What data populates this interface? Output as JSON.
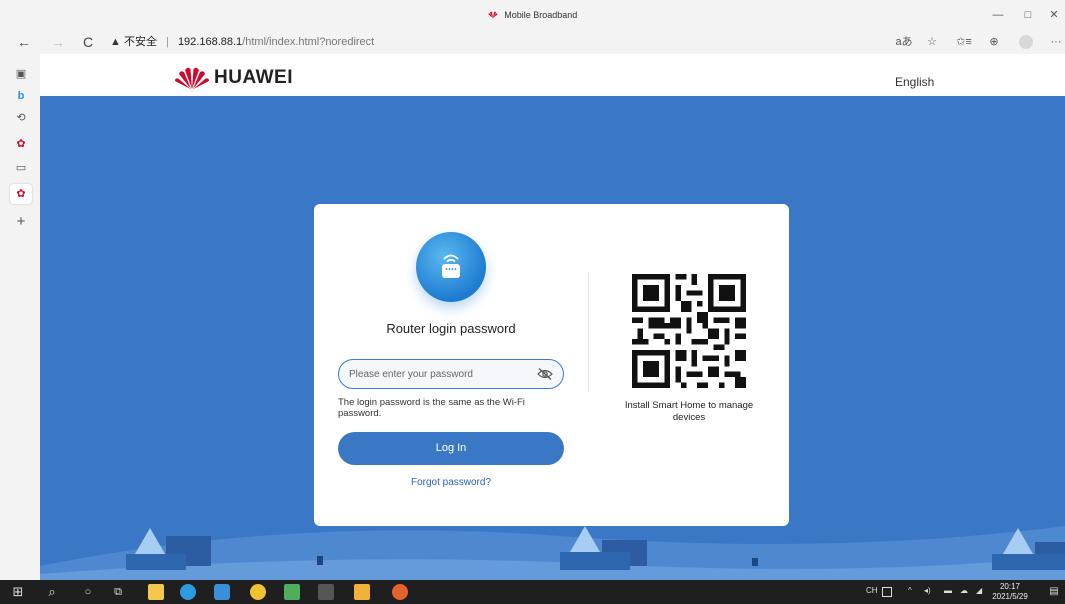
{
  "browser": {
    "tab_title": "Mobile Broadband",
    "minimize": "—",
    "maximize": "□",
    "close": "✕",
    "back": "←",
    "forward": "→",
    "reload": "C",
    "security_icon": "▲",
    "security_label": "不安全",
    "url_host": "192.168.88.1",
    "url_path": "/html/index.html?noredirect",
    "read_aloud": "aあ",
    "add_favorite": "☆",
    "favorites": "✩≡",
    "collections": "⊕",
    "more": "···"
  },
  "sidebar": {
    "items": [
      "▣",
      "b",
      "⟲",
      "✿",
      "▭",
      "✿",
      "+"
    ]
  },
  "header": {
    "brand": "HUAWEI",
    "language": "English"
  },
  "login": {
    "heading": "Router login password",
    "password_placeholder": "Please enter your password",
    "hint": "The login password is the same as the Wi-Fi password.",
    "login_button": "Log In",
    "forgot_link": "Forgot password?",
    "qr_caption": "Install Smart Home to manage devices"
  },
  "taskbar": {
    "start": "⊞",
    "search": "⌕",
    "cortana": "○",
    "taskview": "⧉",
    "ime": "CH",
    "time": "20:17",
    "date": "2021/5/29"
  },
  "colors": {
    "page_bg": "#3a78c5",
    "brand_red": "#cf0a2c",
    "button_blue": "#3a78c5"
  }
}
